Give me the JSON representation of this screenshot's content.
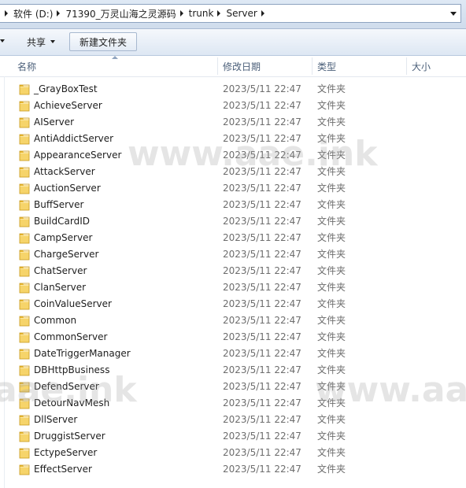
{
  "address_bar": {
    "crumbs": [
      "软件 (D:)",
      "71390_万灵山海之灵源码",
      "trunk",
      "Server"
    ]
  },
  "toolbar": {
    "share_label": "共享",
    "new_folder_label": "新建文件夹"
  },
  "columns": {
    "name": "名称",
    "modified": "修改日期",
    "type": "类型",
    "size": "大小"
  },
  "files": [
    {
      "name": "_GrayBoxTest",
      "modified": "2023/5/11 22:47",
      "type": "文件夹"
    },
    {
      "name": "AchieveServer",
      "modified": "2023/5/11 22:47",
      "type": "文件夹"
    },
    {
      "name": "AIServer",
      "modified": "2023/5/11 22:47",
      "type": "文件夹"
    },
    {
      "name": "AntiAddictServer",
      "modified": "2023/5/11 22:47",
      "type": "文件夹"
    },
    {
      "name": "AppearanceServer",
      "modified": "2023/5/11 22:47",
      "type": "文件夹"
    },
    {
      "name": "AttackServer",
      "modified": "2023/5/11 22:47",
      "type": "文件夹"
    },
    {
      "name": "AuctionServer",
      "modified": "2023/5/11 22:47",
      "type": "文件夹"
    },
    {
      "name": "BuffServer",
      "modified": "2023/5/11 22:47",
      "type": "文件夹"
    },
    {
      "name": "BuildCardID",
      "modified": "2023/5/11 22:47",
      "type": "文件夹"
    },
    {
      "name": "CampServer",
      "modified": "2023/5/11 22:47",
      "type": "文件夹"
    },
    {
      "name": "ChargeServer",
      "modified": "2023/5/11 22:47",
      "type": "文件夹"
    },
    {
      "name": "ChatServer",
      "modified": "2023/5/11 22:47",
      "type": "文件夹"
    },
    {
      "name": "ClanServer",
      "modified": "2023/5/11 22:47",
      "type": "文件夹"
    },
    {
      "name": "CoinValueServer",
      "modified": "2023/5/11 22:47",
      "type": "文件夹"
    },
    {
      "name": "Common",
      "modified": "2023/5/11 22:47",
      "type": "文件夹"
    },
    {
      "name": "CommonServer",
      "modified": "2023/5/11 22:47",
      "type": "文件夹"
    },
    {
      "name": "DateTriggerManager",
      "modified": "2023/5/11 22:47",
      "type": "文件夹"
    },
    {
      "name": "DBHttpBusiness",
      "modified": "2023/5/11 22:47",
      "type": "文件夹"
    },
    {
      "name": "DefendServer",
      "modified": "2023/5/11 22:47",
      "type": "文件夹"
    },
    {
      "name": "DetourNavMesh",
      "modified": "2023/5/11 22:47",
      "type": "文件夹"
    },
    {
      "name": "DllServer",
      "modified": "2023/5/11 22:47",
      "type": "文件夹"
    },
    {
      "name": "DruggistServer",
      "modified": "2023/5/11 22:47",
      "type": "文件夹"
    },
    {
      "name": "EctypeServer",
      "modified": "2023/5/11 22:47",
      "type": "文件夹"
    },
    {
      "name": "EffectServer",
      "modified": "2023/5/11 22:47",
      "type": "文件夹"
    }
  ],
  "watermarks": [
    "www.aae.ink",
    "aae.ink",
    "www.aae"
  ],
  "icons": {
    "folder": "folder-icon",
    "breadcrumb_separator": "chevron-right-icon",
    "dropdown": "chevron-down-icon",
    "sort": "sort-ascending-icon"
  },
  "colors": {
    "folder_yellow": "#f2c94c",
    "header_text": "#4c607a",
    "secondary_text": "#6d6d6d"
  }
}
